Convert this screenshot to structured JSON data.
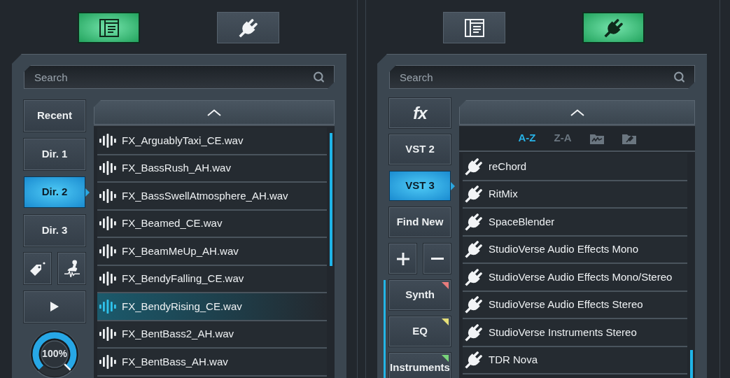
{
  "browsers": [
    {
      "view_buttons": [
        {
          "kind": "library",
          "selected": true
        },
        {
          "kind": "plugins",
          "selected": false
        }
      ],
      "search": {
        "placeholder": "Search"
      },
      "sidebar": [
        {
          "kind": "button",
          "label": "Recent",
          "selected": false
        },
        {
          "kind": "button",
          "label": "Dir. 1",
          "selected": false
        },
        {
          "kind": "button",
          "label": "Dir. 2",
          "selected": true
        },
        {
          "kind": "button",
          "label": "Dir. 3",
          "selected": false
        },
        {
          "kind": "tools"
        },
        {
          "kind": "play"
        },
        {
          "kind": "knob",
          "reading": "100%",
          "level": 1
        }
      ],
      "list": {
        "items": [
          {
            "kind": "audio",
            "name": "FX_ArguablyTaxi_CE.wav",
            "selected": false
          },
          {
            "kind": "audio",
            "name": "FX_BassRush_AH.wav",
            "selected": false
          },
          {
            "kind": "audio",
            "name": "FX_BassSwellAtmosphere_AH.wav",
            "selected": false
          },
          {
            "kind": "audio",
            "name": "FX_Beamed_CE.wav",
            "selected": false
          },
          {
            "kind": "audio",
            "name": "FX_BeamMeUp_AH.wav",
            "selected": false
          },
          {
            "kind": "audio",
            "name": "FX_BendyFalling_CE.wav",
            "selected": false
          },
          {
            "kind": "audio",
            "name": "FX_BendyRising_CE.wav",
            "selected": true
          },
          {
            "kind": "audio",
            "name": "FX_BentBass2_AH.wav",
            "selected": false
          },
          {
            "kind": "audio",
            "name": "FX_BentBass_AH.wav",
            "selected": false
          }
        ]
      }
    },
    {
      "view_buttons": [
        {
          "kind": "library",
          "selected": false
        },
        {
          "kind": "plugins",
          "selected": true
        }
      ],
      "search": {
        "placeholder": "Search"
      },
      "sidebar": [
        {
          "kind": "fx",
          "label": "fx",
          "selected": false
        },
        {
          "kind": "button",
          "label": "VST 2",
          "selected": false
        },
        {
          "kind": "button",
          "label": "VST 3",
          "selected": true
        },
        {
          "kind": "button",
          "label": "Find New",
          "selected": false
        },
        {
          "kind": "add_remove"
        },
        {
          "kind": "category",
          "label": "Synth",
          "color": "#e87c7c",
          "selected": false
        },
        {
          "kind": "category",
          "label": "EQ",
          "color": "#e5df78",
          "selected": false
        },
        {
          "kind": "category",
          "label": "Instruments",
          "color": "#78d47a",
          "selected": false
        }
      ],
      "list": {
        "sort_options": [
          {
            "kind": "text",
            "label": "A-Z",
            "selected": true
          },
          {
            "kind": "text",
            "label": "Z-A",
            "selected": false
          },
          {
            "kind": "folder",
            "selected": false
          },
          {
            "kind": "plugin_folder",
            "selected": false
          }
        ],
        "items": [
          {
            "kind": "plugin",
            "name": "reChord",
            "selected": false
          },
          {
            "kind": "plugin",
            "name": "RitMix",
            "selected": false
          },
          {
            "kind": "plugin",
            "name": "SpaceBlender",
            "selected": false
          },
          {
            "kind": "plugin",
            "name": "StudioVerse Audio Effects Mono",
            "selected": false
          },
          {
            "kind": "plugin",
            "name": "StudioVerse Audio Effects Mono/Stereo",
            "selected": false
          },
          {
            "kind": "plugin",
            "name": "StudioVerse Audio Effects Stereo",
            "selected": false
          },
          {
            "kind": "plugin",
            "name": "StudioVerse Instruments Stereo",
            "selected": false
          },
          {
            "kind": "plugin",
            "name": "TDR Nova",
            "selected": false
          }
        ]
      }
    }
  ]
}
